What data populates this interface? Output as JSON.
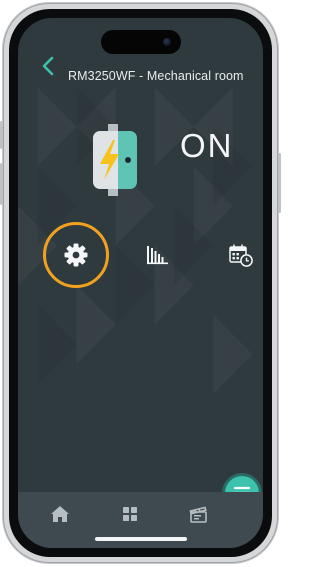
{
  "header": {
    "title": "RM3250WF - Mechanical room"
  },
  "device": {
    "state": "ON",
    "icon": "water-heater-icon",
    "colors": {
      "body": "#dfe3e6",
      "accent": "#5ec4b3",
      "bolt": "#f6c21b"
    }
  },
  "actions": [
    {
      "name": "settings",
      "icon": "gear-icon",
      "highlighted": true
    },
    {
      "name": "statistics",
      "icon": "bar-chart-icon"
    },
    {
      "name": "schedule",
      "icon": "calendar-clock-icon"
    }
  ],
  "tabbar": [
    {
      "name": "home",
      "icon": "home-icon"
    },
    {
      "name": "dashboard",
      "icon": "grid-icon"
    },
    {
      "name": "scenes",
      "icon": "clapperboard-icon"
    }
  ],
  "colors": {
    "background": "#2f3a3f",
    "highlight": "#f0a21f",
    "fab": "#3dc2ad",
    "tabbar": "#3e4a4f"
  }
}
